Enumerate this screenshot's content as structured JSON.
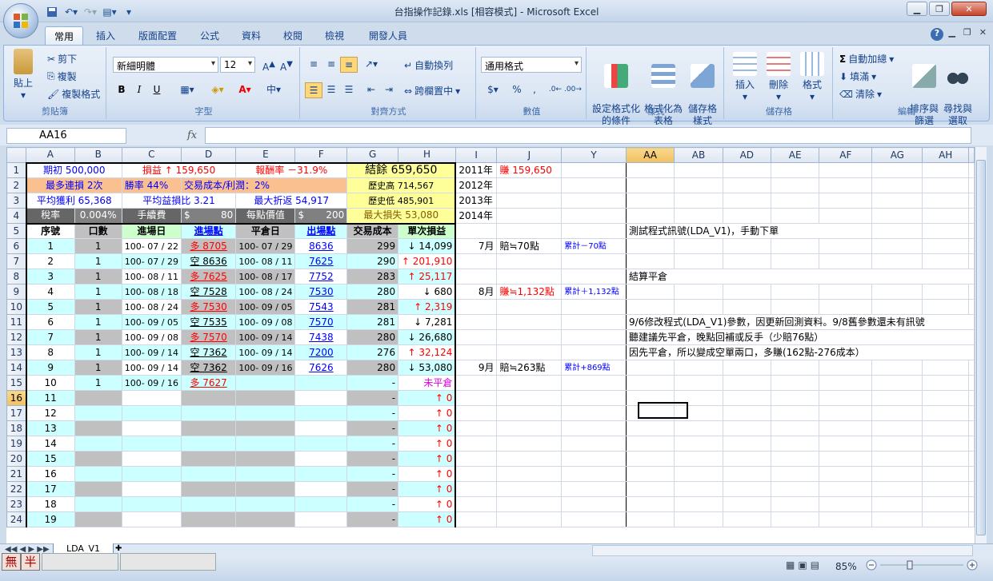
{
  "window": {
    "title": "台指操作記錄.xls  [相容模式] - Microsoft Excel"
  },
  "tabs": [
    "常用",
    "插入",
    "版面配置",
    "公式",
    "資料",
    "校閱",
    "檢視",
    "開發人員"
  ],
  "ribbon": {
    "clipboard": {
      "paste": "貼上",
      "cut": "剪下",
      "copy": "複製",
      "format_painter": "複製格式",
      "label": "剪貼簿"
    },
    "font": {
      "name": "新細明體",
      "size": "12",
      "label": "字型",
      "bold": "B",
      "italic": "I",
      "underline": "U"
    },
    "alignment": {
      "wrap": "自動換列",
      "merge": "跨欄置中",
      "label": "對齊方式"
    },
    "number": {
      "format": "通用格式",
      "label": "數值"
    },
    "styles": {
      "conditional": "設定格式化\n的條件",
      "as_table": "格式化為\n表格",
      "cell_styles": "儲存格\n樣式",
      "label": "樣式"
    },
    "cells": {
      "insert": "插入",
      "delete": "刪除",
      "format": "格式",
      "label": "儲存格"
    },
    "editing": {
      "autosum": "自動加總",
      "fill": "填滿",
      "clear": "清除",
      "sort": "排序與\n篩選",
      "find": "尋找與\n選取",
      "label": "編輯"
    }
  },
  "formula_bar": {
    "name_box": "AA16",
    "fx": "fx",
    "content": ""
  },
  "columns": [
    "A",
    "B",
    "C",
    "D",
    "E",
    "F",
    "G",
    "H",
    "I",
    "J",
    "Y",
    "AA",
    "AB",
    "AD",
    "AE",
    "AF",
    "AG",
    "AH"
  ],
  "summary": {
    "r1": {
      "a": "期初 500,000",
      "c": "損益 ↑ 159,650",
      "e": "報酬率 －31.9%",
      "g": "結餘 659,650",
      "i": "2011年",
      "j": "賺 159,650"
    },
    "r2": {
      "a": "最多連損 2次",
      "c": "勝率 44%",
      "d": "交易成本/利潤：2%",
      "g": "歷史高 714,567",
      "i": "2012年"
    },
    "r3": {
      "a": "平均獲利 65,368",
      "c": "平均益損比 3.21",
      "e": "最大折返 54,917",
      "g": "歷史低 485,901",
      "i": "2013年"
    },
    "r4": {
      "a": "稅率",
      "b": "0.004%",
      "c": "手續費",
      "d1": "$",
      "d2": "80",
      "e": "每點價值",
      "f1": "$",
      "f2": "200",
      "g": "最大損失 53,080",
      "i": "2014年"
    }
  },
  "headers": {
    "a": "序號",
    "b": "口數",
    "c": "進場日",
    "d": "進場點",
    "e": "平倉日",
    "f": "出場點",
    "g": "交易成本",
    "h": "單次損益"
  },
  "trades": [
    {
      "n": "1",
      "q": "1",
      "in_date": "100- 07 / 22",
      "in_pt": "多 8705",
      "long": true,
      "out_date": "100- 07 / 29",
      "out_pt": "8636",
      "cost": "299",
      "pl": "↓ 14,099",
      "up": false
    },
    {
      "n": "2",
      "q": "1",
      "in_date": "100- 07 / 29",
      "in_pt": "空 8636",
      "long": false,
      "out_date": "100- 08 / 11",
      "out_pt": "7625",
      "cost": "290",
      "pl": "↑ 201,910",
      "up": true
    },
    {
      "n": "3",
      "q": "1",
      "in_date": "100- 08 / 11",
      "in_pt": "多 7625",
      "long": true,
      "out_date": "100- 08 / 17",
      "out_pt": "7752",
      "cost": "283",
      "pl": "↑ 25,117",
      "up": true
    },
    {
      "n": "4",
      "q": "1",
      "in_date": "100- 08 / 18",
      "in_pt": "空 7528",
      "long": false,
      "out_date": "100- 08 / 24",
      "out_pt": "7530",
      "cost": "280",
      "pl": "↓ 680",
      "up": false
    },
    {
      "n": "5",
      "q": "1",
      "in_date": "100- 08 / 24",
      "in_pt": "多 7530",
      "long": true,
      "out_date": "100- 09 / 05",
      "out_pt": "7543",
      "cost": "281",
      "pl": "↑ 2,319",
      "up": true
    },
    {
      "n": "6",
      "q": "1",
      "in_date": "100- 09 / 05",
      "in_pt": "空 7535",
      "long": false,
      "out_date": "100- 09 / 08",
      "out_pt": "7570",
      "cost": "281",
      "pl": "↓ 7,281",
      "up": false
    },
    {
      "n": "7",
      "q": "1",
      "in_date": "100- 09 / 08",
      "in_pt": "多 7570",
      "long": true,
      "out_date": "100- 09 / 14",
      "out_pt": "7438",
      "cost": "280",
      "pl": "↓ 26,680",
      "up": false
    },
    {
      "n": "8",
      "q": "1",
      "in_date": "100- 09 / 14",
      "in_pt": "空 7362",
      "long": false,
      "out_date": "100- 09 / 14",
      "out_pt": "7200",
      "cost": "276",
      "pl": "↑ 32,124",
      "up": true
    },
    {
      "n": "9",
      "q": "1",
      "in_date": "100- 09 / 14",
      "in_pt": "空 7362",
      "long": false,
      "out_date": "100- 09 / 16",
      "out_pt": "7626",
      "cost": "280",
      "pl": "↓ 53,080",
      "up": false
    },
    {
      "n": "10",
      "q": "1",
      "in_date": "100- 09 / 16",
      "in_pt": "多 7627",
      "long": true,
      "out_date": "",
      "out_pt": "",
      "cost": "-",
      "pl": "未平倉",
      "up": null
    },
    {
      "n": "11",
      "q": "",
      "in_date": "",
      "in_pt": "",
      "long": null,
      "out_date": "",
      "out_pt": "",
      "cost": "-",
      "pl": "↑ 0",
      "up": true
    },
    {
      "n": "12",
      "q": "",
      "in_date": "",
      "in_pt": "",
      "long": null,
      "out_date": "",
      "out_pt": "",
      "cost": "-",
      "pl": "↑ 0",
      "up": true
    },
    {
      "n": "13",
      "q": "",
      "in_date": "",
      "in_pt": "",
      "long": null,
      "out_date": "",
      "out_pt": "",
      "cost": "-",
      "pl": "↑ 0",
      "up": true
    },
    {
      "n": "14",
      "q": "",
      "in_date": "",
      "in_pt": "",
      "long": null,
      "out_date": "",
      "out_pt": "",
      "cost": "-",
      "pl": "↑ 0",
      "up": true
    },
    {
      "n": "15",
      "q": "",
      "in_date": "",
      "in_pt": "",
      "long": null,
      "out_date": "",
      "out_pt": "",
      "cost": "-",
      "pl": "↑ 0",
      "up": true
    },
    {
      "n": "16",
      "q": "",
      "in_date": "",
      "in_pt": "",
      "long": null,
      "out_date": "",
      "out_pt": "",
      "cost": "-",
      "pl": "↑ 0",
      "up": true
    },
    {
      "n": "17",
      "q": "",
      "in_date": "",
      "in_pt": "",
      "long": null,
      "out_date": "",
      "out_pt": "",
      "cost": "-",
      "pl": "↑ 0",
      "up": true
    },
    {
      "n": "18",
      "q": "",
      "in_date": "",
      "in_pt": "",
      "long": null,
      "out_date": "",
      "out_pt": "",
      "cost": "-",
      "pl": "↑ 0",
      "up": true
    },
    {
      "n": "19",
      "q": "",
      "in_date": "",
      "in_pt": "",
      "long": null,
      "out_date": "",
      "out_pt": "",
      "cost": "-",
      "pl": "↑ 0",
      "up": true
    }
  ],
  "monthly": {
    "6": {
      "i": "7月",
      "j": "賠≒70點",
      "y": "累計－70點"
    },
    "9": {
      "i": "8月",
      "j": "賺≒1,132點",
      "y": "累計＋1,132點"
    },
    "14": {
      "i": "9月",
      "j": "賠≒263點",
      "y": "累計+869點"
    }
  },
  "notes": {
    "5": "測試程式訊號(LDA_V1)，手動下單",
    "8": "結算平倉",
    "11": "9/6修改程式(LDA_V1)參數，因更新回測資料。9/8舊參數還未有訊號",
    "12": "聽建議先平倉，晚點回補或反手（少賠76點）",
    "13": "因先平倉，所以變成空單兩口，多賺(162點-276成本）"
  },
  "sheet_tab": "LDA_V1",
  "status": {
    "zoom": "85%",
    "ime1": "無",
    "ime2": "半"
  }
}
